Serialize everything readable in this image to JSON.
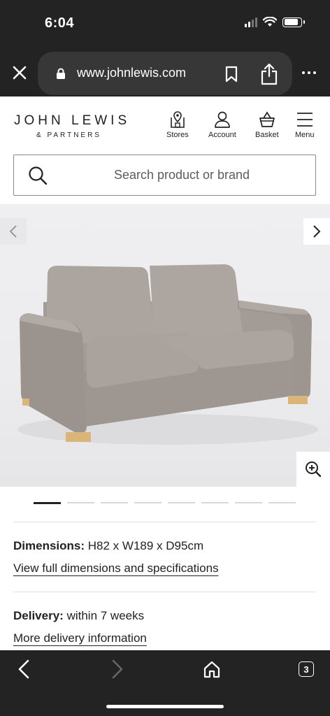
{
  "status_bar": {
    "time": "6:04",
    "battery_level": 0.85
  },
  "browser": {
    "url": "www.johnlewis.com",
    "close_icon": "close-icon",
    "lock_icon": "lock-icon",
    "bookmark_icon": "bookmark-icon",
    "share_icon": "share-icon",
    "more_icon": "more-icon"
  },
  "header": {
    "logo_main": "JOHN LEWIS",
    "logo_sub": "& PARTNERS",
    "nav": [
      {
        "label": "Stores",
        "icon": "store-icon"
      },
      {
        "label": "Account",
        "icon": "account-icon"
      },
      {
        "label": "Basket",
        "icon": "basket-icon"
      },
      {
        "label": "Menu",
        "icon": "menu-icon"
      }
    ]
  },
  "search": {
    "placeholder": "Search product or brand"
  },
  "gallery": {
    "image_alt": "Grey two-seater sofa",
    "slide_count": 8,
    "active_slide": 1
  },
  "details": {
    "dimensions_label": "Dimensions:",
    "dimensions_value": "H82 x W189 x D95cm",
    "dimensions_link": "View full dimensions and specifications",
    "delivery_label": "Delivery:",
    "delivery_value": "within 7 weeks",
    "delivery_link": "More delivery information"
  },
  "toolbar": {
    "tabs_count": "3"
  },
  "colors": {
    "browser_chrome": "#232323",
    "url_pill": "#373737",
    "sofa": "#a39b95"
  }
}
